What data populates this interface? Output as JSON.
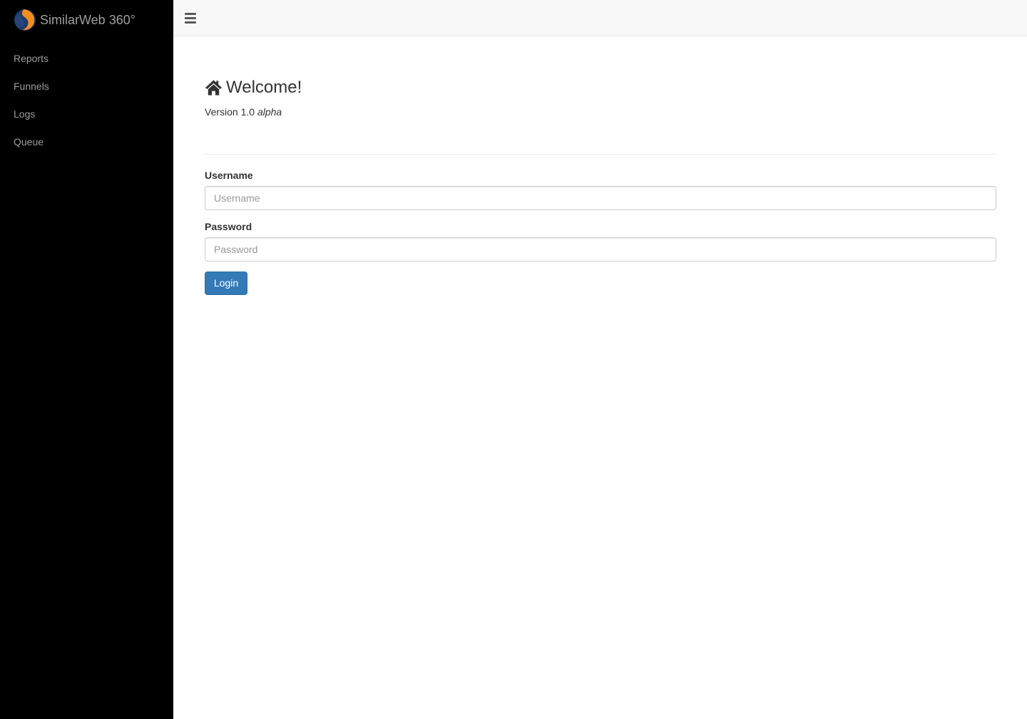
{
  "sidebar": {
    "brand": {
      "name": "SimilarWeb 360°",
      "logo_icon": "similarweb-logo-icon",
      "logo_colors": {
        "blue": "#1f3c6e",
        "orange": "#f48d1f"
      }
    },
    "items": [
      {
        "label": "Reports"
      },
      {
        "label": "Funnels"
      },
      {
        "label": "Logs"
      },
      {
        "label": "Queue"
      }
    ],
    "background": "#000000",
    "text_color": "#9d9d9d"
  },
  "topbar": {
    "menu_icon": "hamburger-menu-icon",
    "background": "#f8f8f8"
  },
  "main": {
    "title_icon": "home-icon",
    "title": "Welcome!",
    "version_prefix": "Version 1.0",
    "version_tag": "alpha",
    "form": {
      "username": {
        "label": "Username",
        "value": "",
        "placeholder": "Username"
      },
      "password": {
        "label": "Password",
        "value": "",
        "placeholder": "Password"
      },
      "submit_label": "Login",
      "submit_color": "#337ab7"
    }
  }
}
